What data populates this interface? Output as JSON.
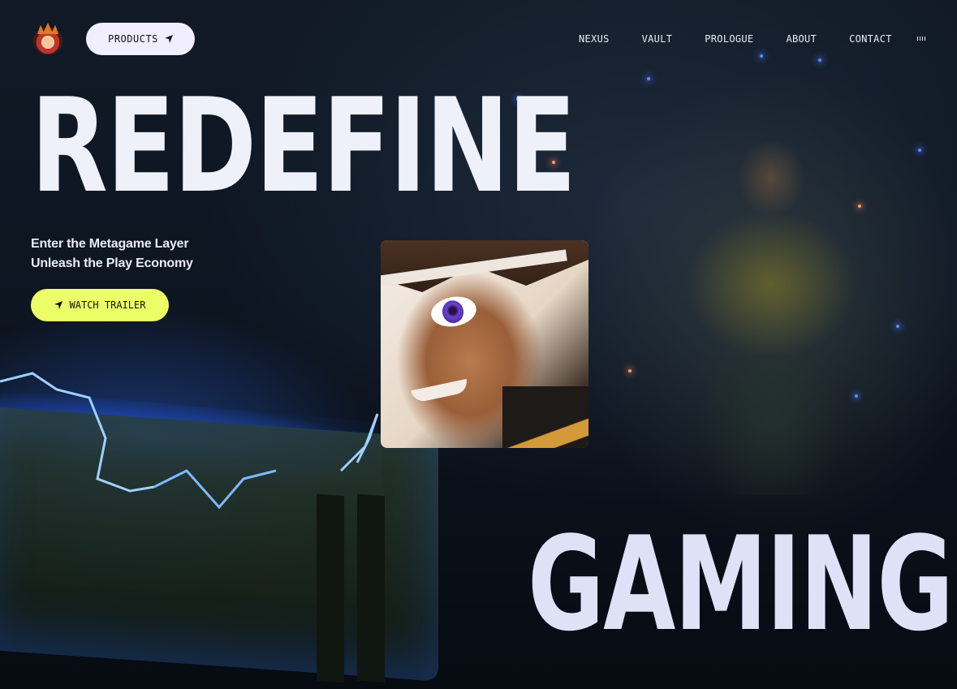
{
  "header": {
    "products_label": "PRODUCTS",
    "nav": [
      {
        "label": "NEXUS"
      },
      {
        "label": "VAULT"
      },
      {
        "label": "PROLOGUE"
      },
      {
        "label": "ABOUT"
      },
      {
        "label": "CONTACT"
      }
    ]
  },
  "hero": {
    "headline_top": "REDEFINE",
    "headline_bottom": "GAMING",
    "tagline_line1": "Enter the Metagame Layer",
    "tagline_line2": "Unleash the Play Economy",
    "trailer_label": "WATCH TRAILER"
  },
  "colors": {
    "accent_yellow": "#edff66",
    "products_bg": "#f1efff",
    "headline": "#eef1fa",
    "background": "#0a0f18"
  },
  "icons": [
    "logo-icon",
    "send-arrow-icon",
    "audio-bars-icon"
  ]
}
